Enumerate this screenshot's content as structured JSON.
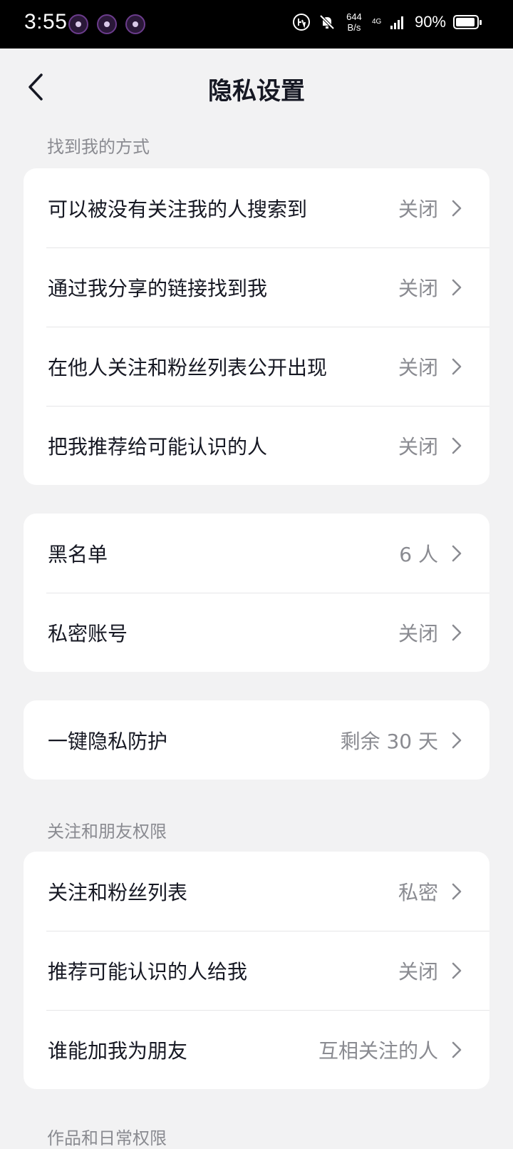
{
  "status_bar": {
    "time": "3:55",
    "net_speed_value": "644",
    "net_speed_unit": "B/s",
    "network_type": "4G",
    "battery": "90%"
  },
  "nav": {
    "title": "隐私设置"
  },
  "sections": {
    "find_me": {
      "header": "找到我的方式",
      "rows": [
        {
          "label": "可以被没有关注我的人搜索到",
          "value": "关闭"
        },
        {
          "label": "通过我分享的链接找到我",
          "value": "关闭"
        },
        {
          "label": "在他人关注和粉丝列表公开出现",
          "value": "关闭"
        },
        {
          "label": "把我推荐给可能认识的人",
          "value": "关闭"
        }
      ]
    },
    "account": {
      "rows": [
        {
          "label": "黑名单",
          "value": "6 人"
        },
        {
          "label": "私密账号",
          "value": "关闭"
        }
      ]
    },
    "protection": {
      "rows": [
        {
          "label": "一键隐私防护",
          "value": "剩余 30 天"
        }
      ]
    },
    "follow_friends": {
      "header": "关注和朋友权限",
      "rows": [
        {
          "label": "关注和粉丝列表",
          "value": "私密"
        },
        {
          "label": "推荐可能认识的人给我",
          "value": "关闭"
        },
        {
          "label": "谁能加我为朋友",
          "value": "互相关注的人"
        }
      ]
    },
    "works_daily": {
      "header": "作品和日常权限"
    }
  },
  "colors": {
    "background": "#f2f2f3",
    "card": "#ffffff",
    "primary_text": "#161823",
    "secondary_text": "#8a8b91"
  }
}
